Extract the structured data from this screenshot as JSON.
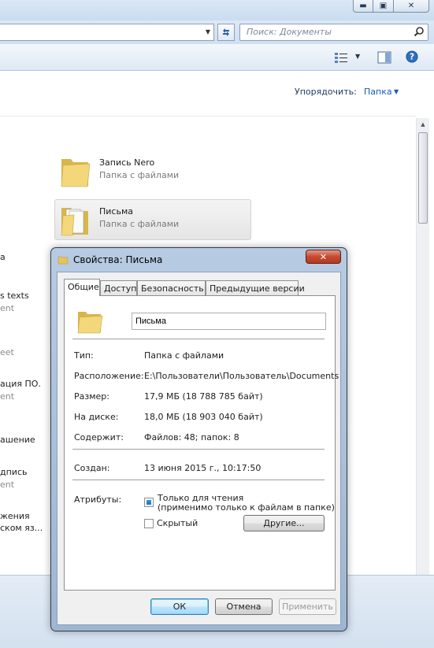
{
  "window": {
    "controls": {
      "minimize": "▬",
      "maximize": "▣",
      "close": "✕"
    }
  },
  "address_bar": {
    "search_placeholder": "Поиск: Документы"
  },
  "toolbar": {
    "views_icon": "views-icon",
    "preview_icon": "preview-pane-icon",
    "help_icon": "help-icon"
  },
  "content": {
    "arrange_label": "Упорядочить:",
    "arrange_value": "Папка",
    "folders": [
      {
        "name": "Запись Nero",
        "type": "Папка с файлами"
      },
      {
        "name": "Письма",
        "type": "Папка с файлами"
      }
    ],
    "left_column_fragments": [
      {
        "text": "а",
        "grey": false
      },
      {
        "text": "s texts",
        "grey": false
      },
      {
        "text": "ent",
        "grey": true
      },
      {
        "text": "eet",
        "grey": true
      },
      {
        "text": "ация ПО.",
        "grey": false
      },
      {
        "text": "ent",
        "grey": true
      },
      {
        "text": "ашение",
        "grey": false
      },
      {
        "text": "дпись",
        "grey": false
      },
      {
        "text": "ent",
        "grey": true
      },
      {
        "text": "жения",
        "grey": false
      },
      {
        "text": "ском яз...",
        "grey": false
      }
    ]
  },
  "dialog": {
    "title": "Свойства: Письма",
    "close": "✕",
    "tabs": [
      "Общие",
      "Доступ",
      "Безопасность",
      "Предыдущие версии"
    ],
    "name_value": "Письма",
    "properties": [
      {
        "label": "Тип:",
        "value": "Папка с файлами"
      },
      {
        "label": "Расположение:",
        "value": "E:\\Пользователи\\Пользователь\\Documents"
      },
      {
        "label": "Размер:",
        "value": "17,9 МБ (18 788 785 байт)"
      },
      {
        "label": "На диске:",
        "value": "18,0 МБ (18 903 040 байт)"
      },
      {
        "label": "Содержит:",
        "value": "Файлов: 48; папок: 8"
      }
    ],
    "created_label": "Создан:",
    "created_value": "13 июня 2015 г., 10:17:50",
    "attributes_label": "Атрибуты:",
    "readonly_label_line1": "Только для чтения",
    "readonly_label_line2": "(применимо только к файлам в папке)",
    "hidden_label": "Скрытый",
    "other_button": "Другие...",
    "ok_button": "ОК",
    "cancel_button": "Отмена",
    "apply_button": "Применить"
  }
}
